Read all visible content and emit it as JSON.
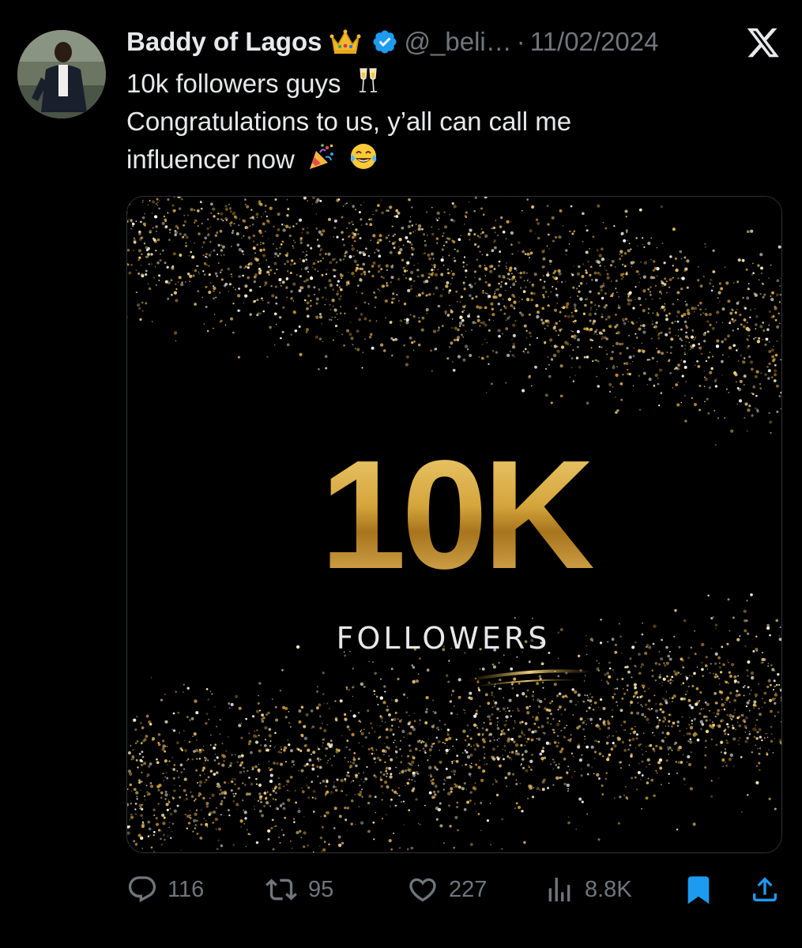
{
  "tweet": {
    "author": {
      "display_name": "Baddy of Lagos",
      "name_emoji": "crown",
      "verified": true,
      "handle": "@_beli…",
      "separator": "·",
      "date": "11/02/2024"
    },
    "text_lines": [
      "10k followers guys",
      "Congratulations to us, y’all can call me",
      "influencer now"
    ],
    "emojis": [
      "clinking-glasses",
      "party-popper",
      "tears-of-joy"
    ],
    "media": {
      "headline": "10K",
      "subheadline": "FOLLOWERS"
    },
    "metrics": {
      "replies": "116",
      "reposts": "95",
      "likes": "227",
      "views": "8.8K"
    },
    "bookmarked": true
  },
  "colors": {
    "background": "#000000",
    "text_primary": "#e7e9ea",
    "text_secondary": "#71767b",
    "verified_blue": "#1d9bf0",
    "bookmark_blue": "#1d9bf0",
    "gold": "#d4a53c"
  },
  "icons": {
    "brand": "x-logo-icon",
    "reply": "reply-icon",
    "repost": "repost-icon",
    "like": "heart-icon",
    "views": "views-icon",
    "bookmark": "bookmark-icon",
    "share": "share-icon"
  }
}
